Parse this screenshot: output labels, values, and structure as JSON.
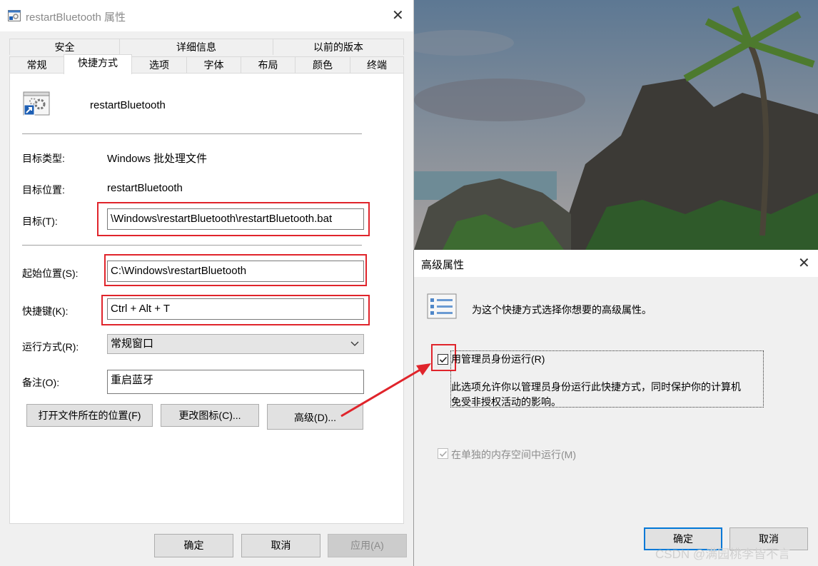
{
  "properties_dialog": {
    "title": "restartBluetooth 属性",
    "tabs_row1": [
      "安全",
      "详细信息",
      "以前的版本"
    ],
    "tabs_row2": [
      "常规",
      "快捷方式",
      "选项",
      "字体",
      "布局",
      "颜色",
      "终端"
    ],
    "active_tab": "快捷方式",
    "shortcut_name": "restartBluetooth",
    "target_type_label": "目标类型:",
    "target_type_value": "Windows 批处理文件",
    "target_location_label": "目标位置:",
    "target_location_value": "restartBluetooth",
    "target_label": "目标(T):",
    "target_value": "\\Windows\\restartBluetooth\\restartBluetooth.bat",
    "start_in_label": "起始位置(S):",
    "start_in_value": "C:\\Windows\\restartBluetooth",
    "shortcut_key_label": "快捷键(K):",
    "shortcut_key_value": "Ctrl + Alt + T",
    "run_label": "运行方式(R):",
    "run_value": "常规窗口",
    "comment_label": "备注(O):",
    "comment_value": "重启蓝牙",
    "open_location_button": "打开文件所在的位置(F)",
    "change_icon_button": "更改图标(C)...",
    "advanced_button": "高级(D)...",
    "ok_button": "确定",
    "cancel_button": "取消",
    "apply_button": "应用(A)"
  },
  "advanced_dialog": {
    "title": "高级属性",
    "description": "为这个快捷方式选择你想要的高级属性。",
    "run_as_admin_label": "用管理员身份运行(R)",
    "run_as_admin_checked": true,
    "run_as_admin_help_line1": "此选项允许你以管理员身份运行此快捷方式，同时保护你的计算机",
    "run_as_admin_help_line2": "免受非授权活动的影响。",
    "separate_memory_label": "在单独的内存空间中运行(M)",
    "separate_memory_checked": true,
    "ok_button": "确定",
    "cancel_button": "取消"
  },
  "watermark": "CSDN @满园桃李皆不言",
  "colors": {
    "highlight_red": "#e0242b",
    "accent_blue": "#0078d7"
  }
}
